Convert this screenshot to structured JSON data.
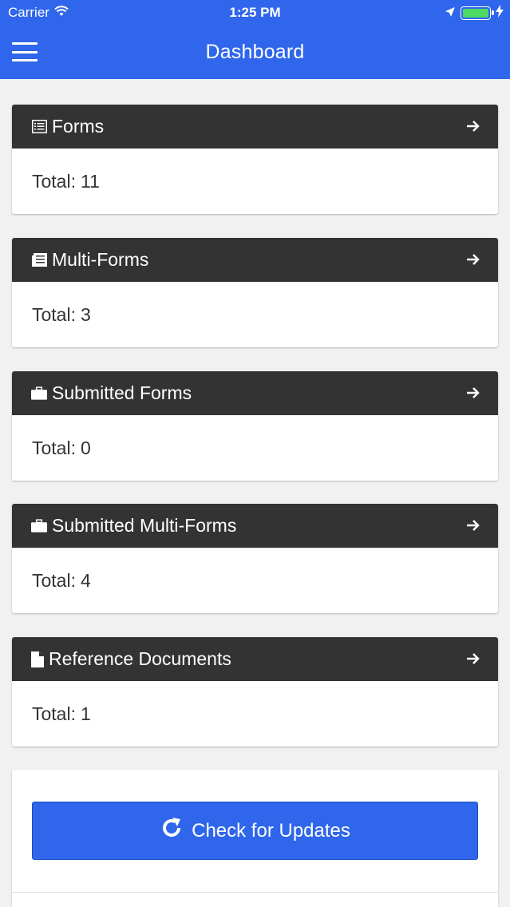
{
  "statusbar": {
    "carrier": "Carrier",
    "time": "1:25 PM",
    "wifi_icon": "wifi-icon",
    "location_icon": "location-arrow-icon",
    "battery_icon": "battery-icon",
    "charging_icon": "bolt-icon"
  },
  "header": {
    "title": "Dashboard",
    "menu_icon": "hamburger-menu-icon",
    "bg_color": "#2f66eb"
  },
  "cards": [
    {
      "title": "Forms",
      "icon": "list-icon",
      "total_label": "Total:",
      "total": "11"
    },
    {
      "title": "Multi-Forms",
      "icon": "newspaper-icon",
      "total_label": "Total:",
      "total": "3"
    },
    {
      "title": "Submitted Forms",
      "icon": "briefcase-icon",
      "total_label": "Total:",
      "total": "0"
    },
    {
      "title": "Submitted Multi-Forms",
      "icon": "briefcase-icon",
      "total_label": "Total:",
      "total": "4"
    },
    {
      "title": "Reference Documents",
      "icon": "file-icon",
      "total_label": "Total:",
      "total": "1"
    }
  ],
  "card_arrow_icon": "arrow-right-icon",
  "update_button": {
    "label": "Check for Updates",
    "icon": "refresh-icon"
  },
  "colors": {
    "accent": "#2f66eb",
    "card_header": "#333333",
    "background": "#f1f1f1"
  }
}
